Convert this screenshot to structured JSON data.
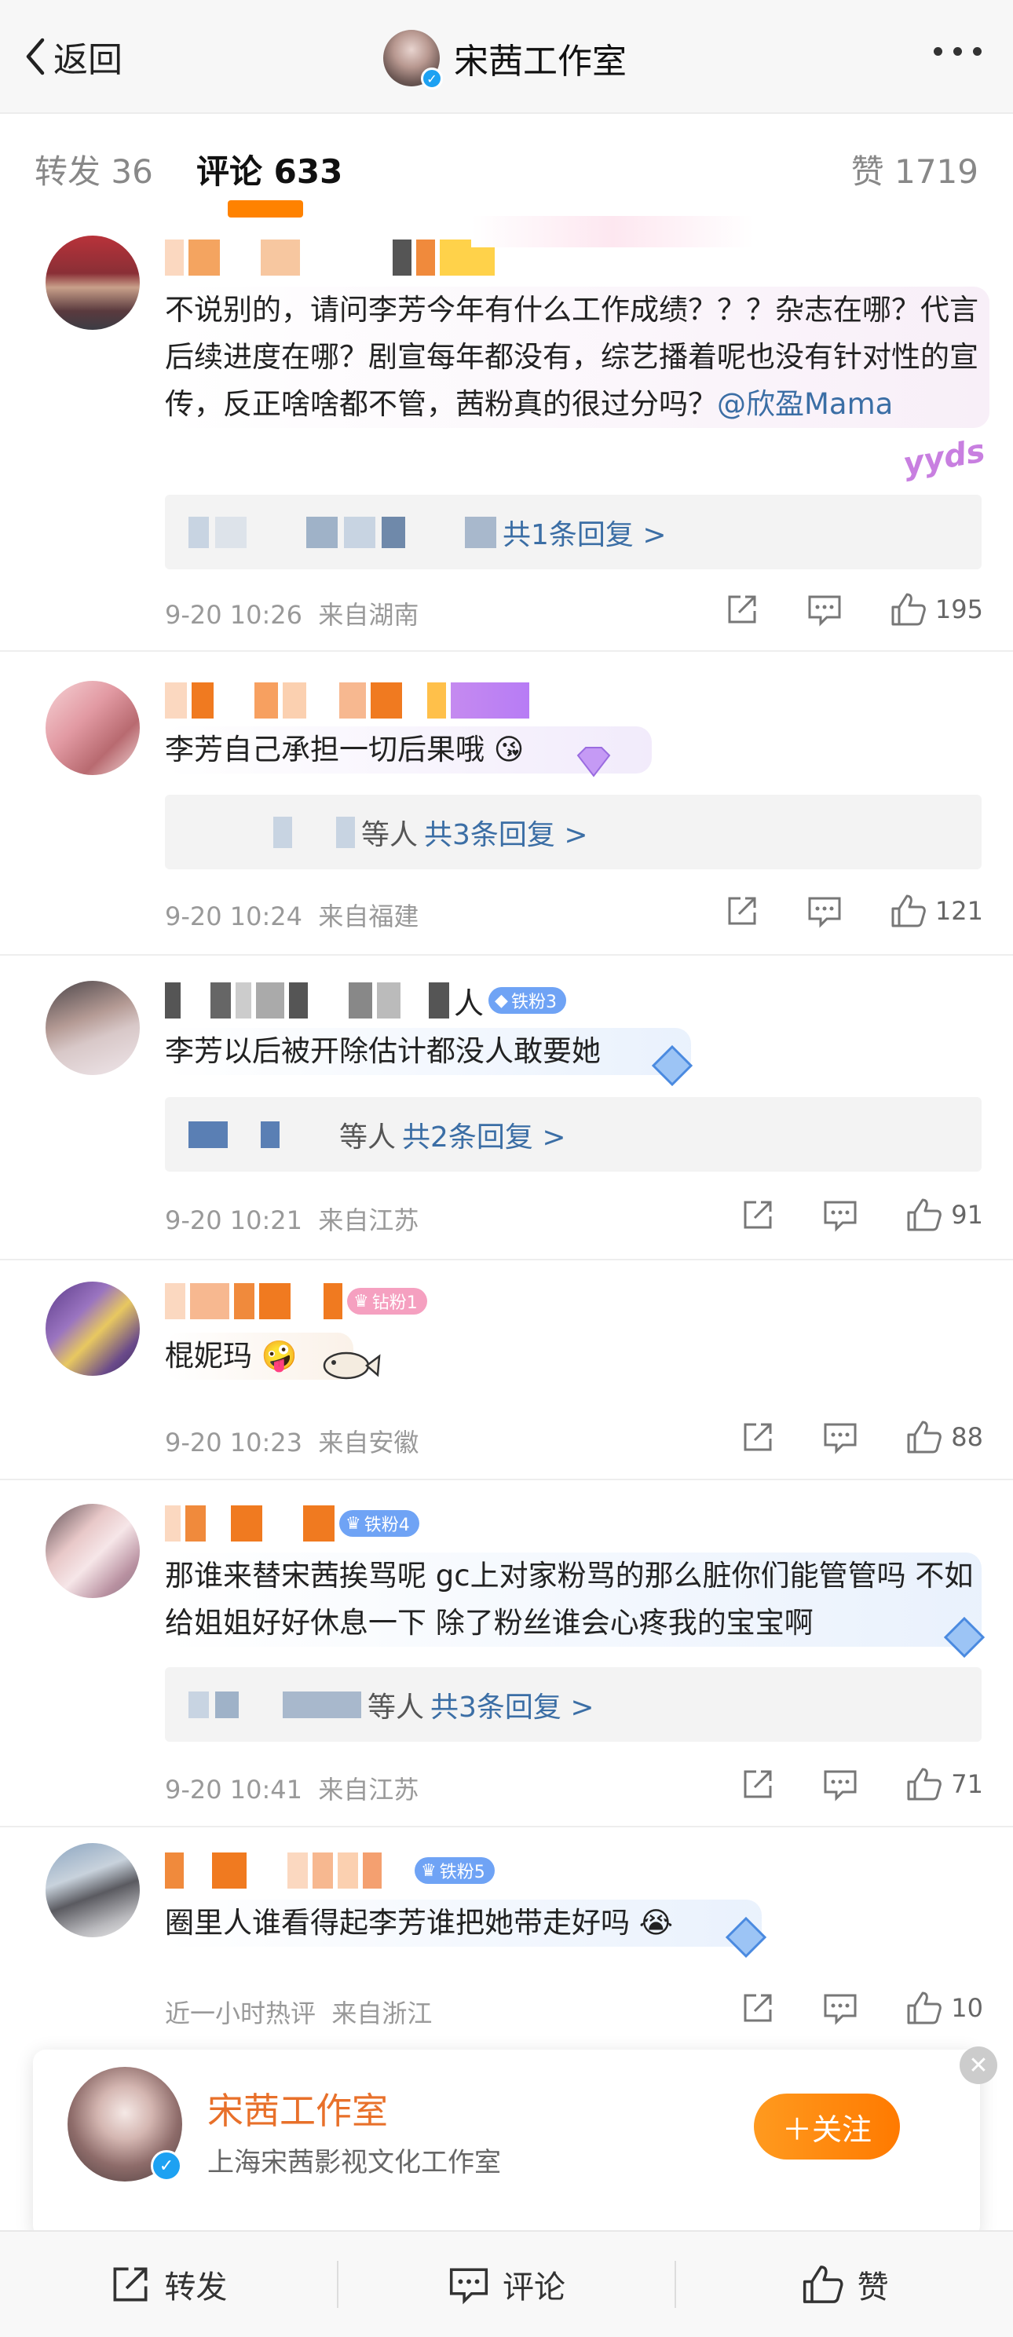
{
  "header": {
    "back_label": "返回",
    "title": "宋茜工作室"
  },
  "tabs": {
    "repost": "转发 36",
    "comments": "评论 633",
    "likes": "赞 1719"
  },
  "comments": [
    {
      "text_before": "不说别的，请问李芳今年有什么工作成绩？？？杂志在哪？代言后续进度在哪？剧宣每年都没有，综艺播着呢也没有针对性的宣传，反正啥啥都不管，茜粉真的很过分吗？",
      "mention": "@欣盈Mama",
      "sticker": "yyds",
      "reply": "共1条回复 >",
      "time": "9-20 10:26",
      "location": "来自湖南",
      "likes": "195"
    },
    {
      "text": "李芳自己承担一切后果哦",
      "emoji": "😘",
      "reply_prefix": "等人",
      "reply": "共3条回复 >",
      "time": "9-20 10:24",
      "location": "来自福建",
      "likes": "121"
    },
    {
      "name_suffix": "人",
      "badge": "铁粉3",
      "text": "李芳以后被开除估计都没人敢要她",
      "reply_prefix": "等人",
      "reply": "共2条回复 >",
      "time": "9-20 10:21",
      "location": "来自江苏",
      "likes": "91"
    },
    {
      "badge": "钻粉1",
      "text": "棍妮玛",
      "emoji": "🤪",
      "time": "9-20 10:23",
      "location": "来自安徽",
      "likes": "88"
    },
    {
      "badge": "铁粉4",
      "text": "那谁来替宋茜挨骂呢 gc上对家粉骂的那么脏你们能管管吗 不如给姐姐好好休息一下 除了粉丝谁会心疼我的宝宝啊",
      "reply_prefix": "等人",
      "reply": "共3条回复 >",
      "time": "9-20 10:41",
      "location": "来自江苏",
      "likes": "71"
    },
    {
      "badge": "铁粉5",
      "text": "圈里人谁看得起李芳谁把她带走好吗",
      "emoji": "😭",
      "time": "近一小时热评",
      "location": "来自浙江",
      "likes": "10"
    }
  ],
  "follow_card": {
    "name": "宋茜工作室",
    "subtitle": "上海宋茜影视文化工作室",
    "button": "＋关注",
    "close": "✕"
  },
  "bottom": {
    "repost": "转发",
    "comment": "评论",
    "like": "赞"
  },
  "colors": {
    "accent": "#ff8200",
    "link": "#3b6ea5",
    "badge_iron": "#6fa3f5",
    "badge_diamond": "#f5a623"
  }
}
